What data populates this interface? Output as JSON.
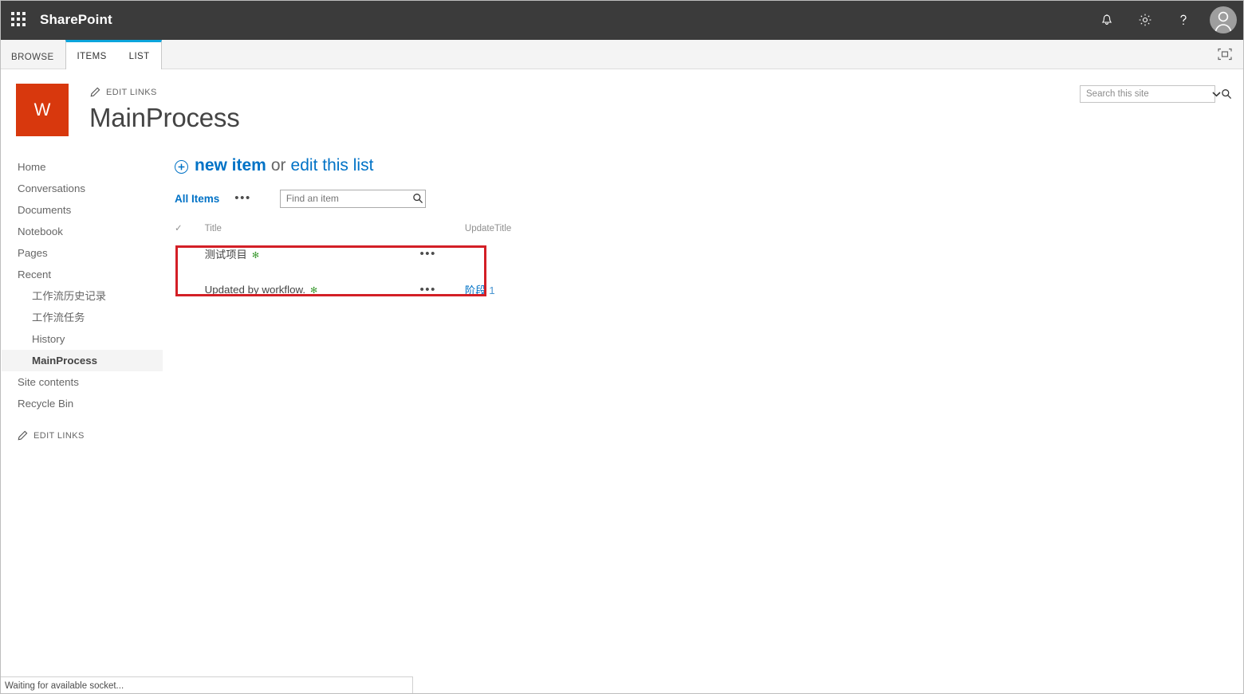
{
  "suite_bar": {
    "app_launcher": "app-launcher",
    "brand": "SharePoint",
    "icons": [
      "notifications-bell",
      "settings-gear",
      "help-question",
      "user-avatar"
    ]
  },
  "ribbon": {
    "tabs": [
      {
        "label": "BROWSE",
        "contextual": false,
        "active": false
      },
      {
        "label": "ITEMS",
        "contextual": true,
        "active": true
      },
      {
        "label": "LIST",
        "contextual": true,
        "active": false
      }
    ],
    "focus_on_content": "focus-on-content",
    "contextual_accent": "#0ca5dc"
  },
  "search": {
    "placeholder": "Search this site",
    "value": "",
    "dropdown_icon": "chevron-down-icon",
    "search_icon": "search-icon"
  },
  "site_header": {
    "logo_letter": "W",
    "logo_color": "#d8380d",
    "edit_links": "EDIT LINKS",
    "title": "MainProcess"
  },
  "sidebar": {
    "items": [
      {
        "label": "Home",
        "sub": false,
        "selected": false
      },
      {
        "label": "Conversations",
        "sub": false,
        "selected": false
      },
      {
        "label": "Documents",
        "sub": false,
        "selected": false
      },
      {
        "label": "Notebook",
        "sub": false,
        "selected": false
      },
      {
        "label": "Pages",
        "sub": false,
        "selected": false
      },
      {
        "label": "Recent",
        "sub": false,
        "selected": false
      },
      {
        "label": "工作流历史记录",
        "sub": true,
        "selected": false
      },
      {
        "label": "工作流任务",
        "sub": true,
        "selected": false
      },
      {
        "label": "History",
        "sub": true,
        "selected": false
      },
      {
        "label": "MainProcess",
        "sub": true,
        "selected": true
      },
      {
        "label": "Site contents",
        "sub": false,
        "selected": false
      },
      {
        "label": "Recycle Bin",
        "sub": false,
        "selected": false
      }
    ],
    "edit_links": "EDIT LINKS"
  },
  "main": {
    "new_item_label": "new item",
    "or_text": "or",
    "edit_list_label": "edit this list",
    "view_name": "All Items",
    "view_menu": "•••",
    "find_placeholder": "Find an item",
    "find_value": "",
    "columns": [
      "",
      "Title",
      "",
      "UpdateTitle"
    ],
    "rows": [
      {
        "title": "测试项目",
        "new_flag": "✻",
        "menu": "•••",
        "update_title": "",
        "update_title_num": ""
      },
      {
        "title": "Updated by workflow.",
        "new_flag": "✻",
        "menu": "•••",
        "update_title": "阶段",
        "update_title_num": "1"
      }
    ]
  },
  "annotation": {
    "color": "#d31f26",
    "note": "highlight-box-around-workflow-row"
  },
  "status_bar": {
    "text": "Waiting for available socket..."
  },
  "colors": {
    "suite_bar": "#3b3b3b",
    "link": "#0072c6",
    "accent_tab": "#0ca5dc",
    "logo": "#d8380d",
    "new_flag": "#3f9c35",
    "annotation": "#d31f26"
  }
}
